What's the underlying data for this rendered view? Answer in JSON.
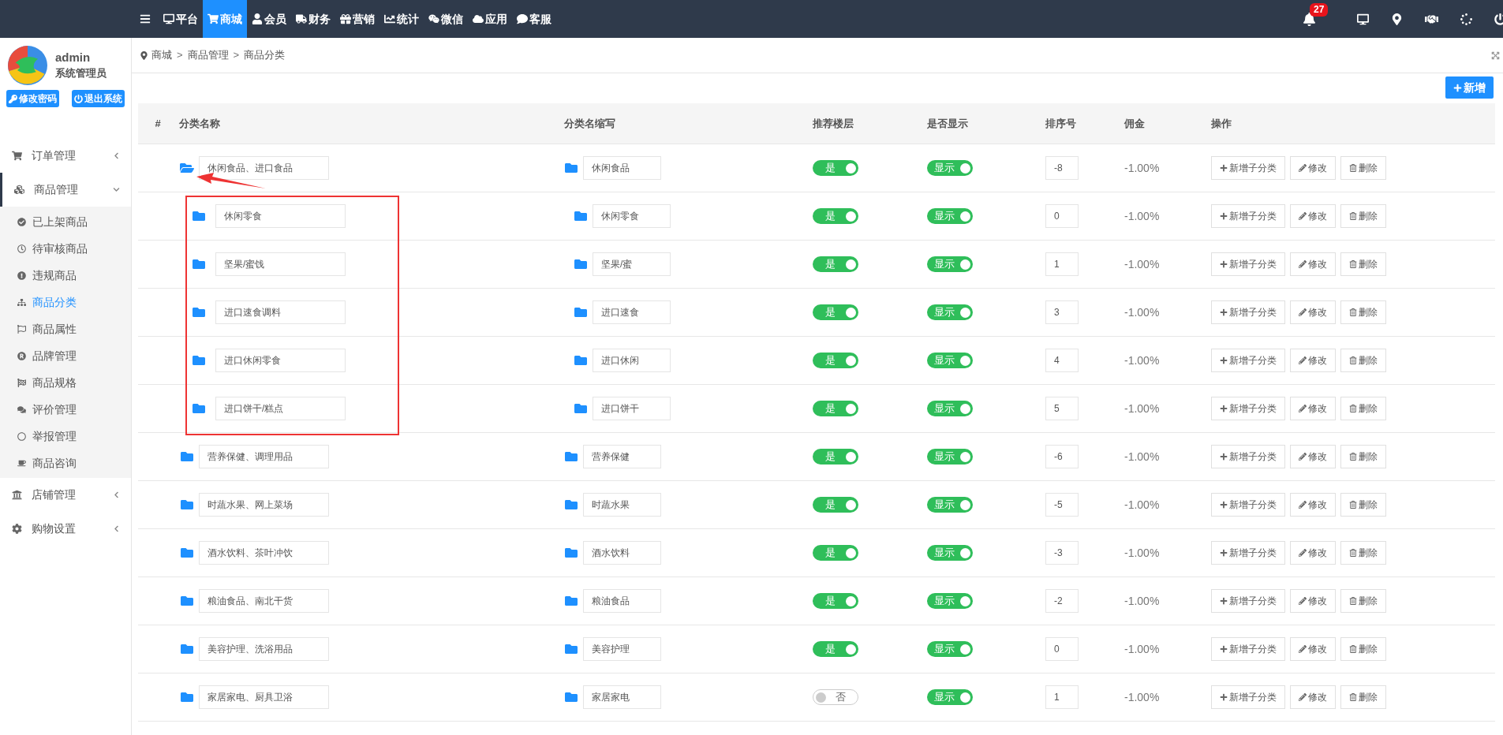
{
  "topbar": {
    "nav": [
      {
        "label": "平台",
        "selected": false
      },
      {
        "label": "商城",
        "selected": true
      },
      {
        "label": "会员",
        "selected": false
      },
      {
        "label": "财务",
        "selected": false
      },
      {
        "label": "营销",
        "selected": false
      },
      {
        "label": "统计",
        "selected": false
      },
      {
        "label": "微信",
        "selected": false
      },
      {
        "label": "应用",
        "selected": false
      },
      {
        "label": "客服",
        "selected": false
      }
    ],
    "notification_count": "27"
  },
  "user": {
    "name": "admin",
    "role": "系统管理员",
    "buttons": [
      "修改密码",
      "退出系统"
    ]
  },
  "sidebar": {
    "items": [
      {
        "label": "订单管理",
        "expanded": false
      },
      {
        "label": "商品管理",
        "expanded": true,
        "children": [
          {
            "label": "已上架商品",
            "selected": false
          },
          {
            "label": "待审核商品",
            "selected": false
          },
          {
            "label": "违规商品",
            "selected": false
          },
          {
            "label": "商品分类",
            "selected": true
          },
          {
            "label": "商品属性",
            "selected": false
          },
          {
            "label": "品牌管理",
            "selected": false
          },
          {
            "label": "商品规格",
            "selected": false
          },
          {
            "label": "评价管理",
            "selected": false
          },
          {
            "label": "举报管理",
            "selected": false
          },
          {
            "label": "商品咨询",
            "selected": false
          }
        ]
      },
      {
        "label": "店铺管理",
        "expanded": false
      },
      {
        "label": "购物设置",
        "expanded": false
      }
    ]
  },
  "breadcrumb": [
    {
      "kind": "link",
      "text": "商城"
    },
    {
      "kind": "separator",
      "text": ">"
    },
    {
      "kind": "link",
      "text": "商品管理"
    },
    {
      "kind": "separator",
      "text": ">"
    },
    {
      "kind": "link",
      "text": "商品分类"
    }
  ],
  "add_button": "新增",
  "table": {
    "columns": [
      "#",
      "分类名称",
      "分类名缩写",
      "推荐楼层",
      "是否显示",
      "排序号",
      "佣金",
      "操作"
    ],
    "rows": [
      {
        "name": "休闲食品、进口食品",
        "abbr": "休闲食品",
        "recommend": {
          "on": true,
          "label": "是"
        },
        "show": {
          "on": true,
          "label": "显示"
        },
        "sort": "-8",
        "commission": "-1.00%",
        "actions": [
          "新增子分类",
          "修改",
          "删除"
        ],
        "expanded": true,
        "children": [
          {
            "name": "休闲零食",
            "abbr": "休闲零食",
            "recommend": {
              "on": true,
              "label": "是"
            },
            "show": {
              "on": true,
              "label": "显示"
            },
            "sort": "0",
            "commission": "-1.00%",
            "actions": [
              "新增子分类",
              "修改",
              "删除"
            ]
          },
          {
            "name": "坚果/蜜饯",
            "abbr": "坚果/蜜",
            "recommend": {
              "on": true,
              "label": "是"
            },
            "show": {
              "on": true,
              "label": "显示"
            },
            "sort": "1",
            "commission": "-1.00%",
            "actions": [
              "新增子分类",
              "修改",
              "删除"
            ]
          },
          {
            "name": "进口速食调料",
            "abbr": "进口速食",
            "recommend": {
              "on": true,
              "label": "是"
            },
            "show": {
              "on": true,
              "label": "显示"
            },
            "sort": "3",
            "commission": "-1.00%",
            "actions": [
              "新增子分类",
              "修改",
              "删除"
            ]
          },
          {
            "name": "进口休闲零食",
            "abbr": "进口休闲",
            "recommend": {
              "on": true,
              "label": "是"
            },
            "show": {
              "on": true,
              "label": "显示"
            },
            "sort": "4",
            "commission": "-1.00%",
            "actions": [
              "新增子分类",
              "修改",
              "删除"
            ]
          },
          {
            "name": "进口饼干/糕点",
            "abbr": "进口饼干",
            "recommend": {
              "on": true,
              "label": "是"
            },
            "show": {
              "on": true,
              "label": "显示"
            },
            "sort": "5",
            "commission": "-1.00%",
            "actions": [
              "新增子分类",
              "修改",
              "删除"
            ]
          }
        ]
      },
      {
        "name": "营养保健、调理用品",
        "abbr": "营养保健",
        "recommend": {
          "on": true,
          "label": "是"
        },
        "show": {
          "on": true,
          "label": "显示"
        },
        "sort": "-6",
        "commission": "-1.00%",
        "actions": [
          "新增子分类",
          "修改",
          "删除"
        ],
        "expanded": false
      },
      {
        "name": "时蔬水果、网上菜场",
        "abbr": "时蔬水果",
        "recommend": {
          "on": true,
          "label": "是"
        },
        "show": {
          "on": true,
          "label": "显示"
        },
        "sort": "-5",
        "commission": "-1.00%",
        "actions": [
          "新增子分类",
          "修改",
          "删除"
        ],
        "expanded": false
      },
      {
        "name": "酒水饮料、茶叶冲饮",
        "abbr": "酒水饮料",
        "recommend": {
          "on": true,
          "label": "是"
        },
        "show": {
          "on": true,
          "label": "显示"
        },
        "sort": "-3",
        "commission": "-1.00%",
        "actions": [
          "新增子分类",
          "修改",
          "删除"
        ],
        "expanded": false
      },
      {
        "name": "粮油食品、南北干货",
        "abbr": "粮油食品",
        "recommend": {
          "on": true,
          "label": "是"
        },
        "show": {
          "on": true,
          "label": "显示"
        },
        "sort": "-2",
        "commission": "-1.00%",
        "actions": [
          "新增子分类",
          "修改",
          "删除"
        ],
        "expanded": false
      },
      {
        "name": "美容护理、洗浴用品",
        "abbr": "美容护理",
        "recommend": {
          "on": true,
          "label": "是"
        },
        "show": {
          "on": true,
          "label": "显示"
        },
        "sort": "0",
        "commission": "-1.00%",
        "actions": [
          "新增子分类",
          "修改",
          "删除"
        ],
        "expanded": false
      },
      {
        "name": "家居家电、厨具卫浴",
        "abbr": "家居家电",
        "recommend": {
          "on": false,
          "label": "否"
        },
        "show": {
          "on": true,
          "label": "显示"
        },
        "sort": "1",
        "commission": "-1.00%",
        "actions": [
          "新增子分类",
          "修改",
          "删除"
        ],
        "expanded": false
      }
    ]
  }
}
